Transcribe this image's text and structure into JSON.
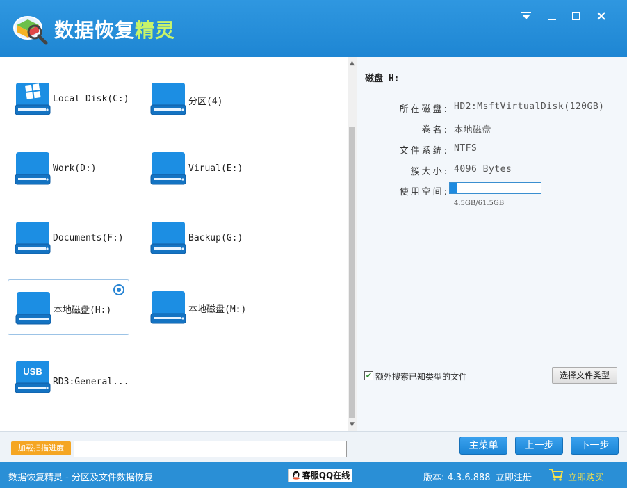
{
  "app": {
    "title_prefix": "数据恢复",
    "title_suffix": "精灵"
  },
  "window_controls": [
    "menu",
    "minimize",
    "maximize",
    "close"
  ],
  "disks": [
    {
      "label": "Local Disk(C:)",
      "icon": "windows-drive-icon",
      "selected": false
    },
    {
      "label": "分区(4)",
      "icon": "drive-icon",
      "selected": false
    },
    {
      "label": "Work(D:)",
      "icon": "drive-icon",
      "selected": false
    },
    {
      "label": "Virual(E:)",
      "icon": "drive-icon",
      "selected": false
    },
    {
      "label": "Documents(F:)",
      "icon": "drive-icon",
      "selected": false
    },
    {
      "label": "Backup(G:)",
      "icon": "drive-icon",
      "selected": false
    },
    {
      "label": "本地磁盘(H:)",
      "icon": "drive-icon",
      "selected": true
    },
    {
      "label": "本地磁盘(M:)",
      "icon": "drive-icon",
      "selected": false
    },
    {
      "label": "RD3:General...",
      "icon": "usb-drive-icon",
      "selected": false,
      "usb_text": "USB"
    }
  ],
  "info": {
    "title": "磁盘 H:",
    "rows": [
      {
        "key": "所在磁盘:",
        "value": "HD2:MsftVirtualDisk(120GB)"
      },
      {
        "key": "卷名:",
        "value": "本地磁盘"
      },
      {
        "key": "文件系统:",
        "value": "NTFS"
      },
      {
        "key": "簇大小:",
        "value": "4096 Bytes"
      },
      {
        "key": "使用空间:",
        "value": ""
      }
    ],
    "usage_fraction": 0.073,
    "usage_text": "4.5GB/61.5GB",
    "extra_search_label": "额外搜索已知类型的文件",
    "extra_search_checked": true,
    "choose_type_button": "选择文件类型"
  },
  "bottom": {
    "load_button": "加载扫描进度",
    "main_menu": "主菜单",
    "prev": "上一步",
    "next": "下一步"
  },
  "status": {
    "left": "数据恢复精灵 - 分区及文件数据恢复",
    "qq": "客服QQ在线",
    "version": "版本: 4.3.6.888",
    "register": "立即注册",
    "buy": "立即购买"
  },
  "colors": {
    "brand_blue": "#2a8fd6",
    "accent_green": "#c8f36a",
    "buy_yellow": "#f5e04a",
    "load_orange": "#f5a623"
  }
}
